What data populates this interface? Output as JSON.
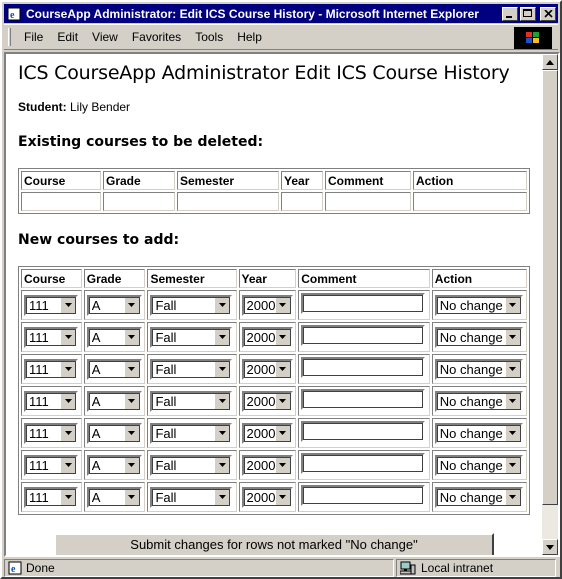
{
  "window": {
    "title": "CourseApp Administrator: Edit ICS Course History - Microsoft Internet Explorer"
  },
  "menu": [
    "File",
    "Edit",
    "View",
    "Favorites",
    "Tools",
    "Help"
  ],
  "page": {
    "heading": "ICS CourseApp Administrator Edit ICS Course History",
    "student_label": "Student:",
    "student_name": "Lily Bender",
    "existing_heading": "Existing courses to be deleted:",
    "new_heading": "New courses to add:"
  },
  "existing_table": {
    "headers": [
      "Course",
      "Grade",
      "Semester",
      "Year",
      "Comment",
      "Action"
    ]
  },
  "new_table": {
    "headers": [
      "Course",
      "Grade",
      "Semester",
      "Year",
      "Comment",
      "Action"
    ],
    "rows": [
      {
        "course": "111",
        "grade": "A",
        "semester": "Fall",
        "year": "2000",
        "comment": "",
        "action": "No change"
      },
      {
        "course": "111",
        "grade": "A",
        "semester": "Fall",
        "year": "2000",
        "comment": "",
        "action": "No change"
      },
      {
        "course": "111",
        "grade": "A",
        "semester": "Fall",
        "year": "2000",
        "comment": "",
        "action": "No change"
      },
      {
        "course": "111",
        "grade": "A",
        "semester": "Fall",
        "year": "2000",
        "comment": "",
        "action": "No change"
      },
      {
        "course": "111",
        "grade": "A",
        "semester": "Fall",
        "year": "2000",
        "comment": "",
        "action": "No change"
      },
      {
        "course": "111",
        "grade": "A",
        "semester": "Fall",
        "year": "2000",
        "comment": "",
        "action": "No change"
      },
      {
        "course": "111",
        "grade": "A",
        "semester": "Fall",
        "year": "2000",
        "comment": "",
        "action": "No change"
      }
    ]
  },
  "submit_label": "Submit changes for rows not marked \"No change\"",
  "status": {
    "left": "Done",
    "zone": "Local intranet"
  },
  "colors": {
    "titlebar": "#000080",
    "chrome": "#d4d0c8"
  }
}
